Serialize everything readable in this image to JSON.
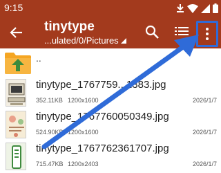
{
  "status_bar": {
    "time": "9:15",
    "icons": [
      "download-icon",
      "wifi-icon",
      "cellular-icon",
      "battery-icon"
    ]
  },
  "toolbar": {
    "title": "tinytype",
    "path": "...ulated/0/Pictures",
    "icons": [
      "back-arrow-icon",
      "search-icon",
      "list-view-icon",
      "more-vert-icon"
    ],
    "accent_color": "#a33a1d"
  },
  "parent_entry": {
    "label": ".."
  },
  "files": [
    {
      "name": "tinytype_1767759...1383.jpg",
      "size": "352.11KB",
      "resolution": "1200x1600",
      "date": "2026/1/7"
    },
    {
      "name": "tinytype_1767760050349.jpg",
      "size": "524.90KB",
      "resolution": "1200x1600",
      "date": "2026/1/7"
    },
    {
      "name": "tinytype_1767762361707.jpg",
      "size": "715.47KB",
      "resolution": "1200x2403",
      "date": "2026/1/7"
    }
  ],
  "annotation": {
    "highlight_color": "#2f6bd8"
  }
}
